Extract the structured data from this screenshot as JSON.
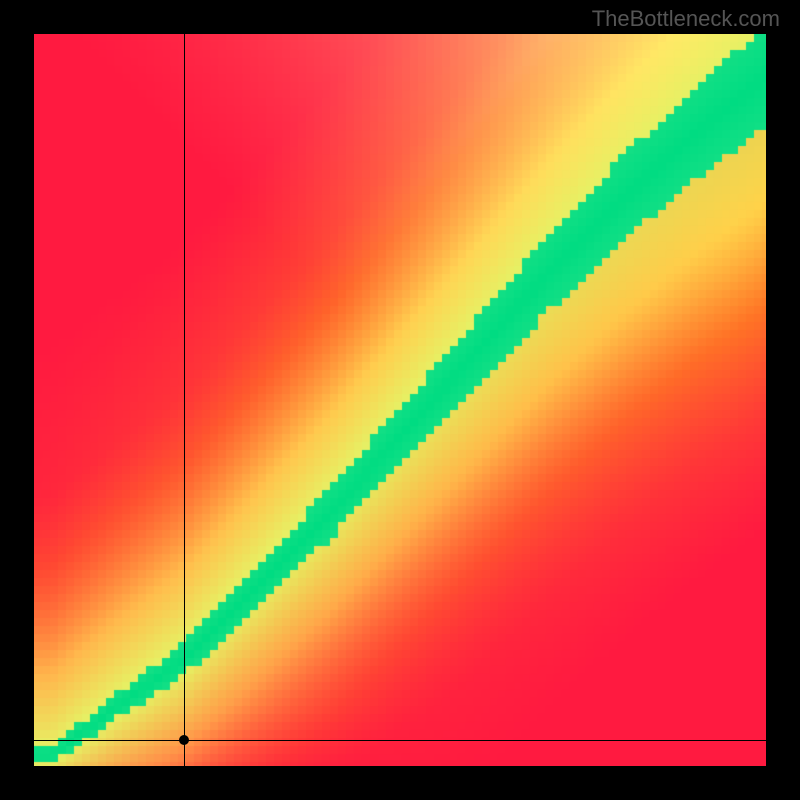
{
  "watermark": "TheBottleneck.com",
  "frame": {
    "outer_w": 800,
    "outer_h": 800,
    "inner_left": 34,
    "inner_top": 34,
    "inner_w": 732,
    "inner_h": 732
  },
  "crosshair": {
    "x_frac": 0.205,
    "y_frac": 0.965
  },
  "chart_data": {
    "type": "heatmap",
    "title": "",
    "xlabel": "",
    "ylabel": "",
    "xlim": [
      0,
      100
    ],
    "ylim": [
      0,
      100
    ],
    "colorscale_note": "red (low) → orange/yellow (mid) → green (optimal ridge) → yellow (high)",
    "marker": {
      "x": 20.5,
      "y": 3.5
    },
    "optimal_ridge": {
      "description": "Green ridge indicating balanced pairing; curve from bottom-left to top-right, slightly convex, widening toward top-right",
      "points": [
        {
          "x": 2,
          "y": 2
        },
        {
          "x": 10,
          "y": 8
        },
        {
          "x": 20,
          "y": 15
        },
        {
          "x": 30,
          "y": 25
        },
        {
          "x": 40,
          "y": 35
        },
        {
          "x": 50,
          "y": 46
        },
        {
          "x": 60,
          "y": 57
        },
        {
          "x": 70,
          "y": 68
        },
        {
          "x": 80,
          "y": 78
        },
        {
          "x": 90,
          "y": 87
        },
        {
          "x": 100,
          "y": 95
        }
      ],
      "width_start": 2,
      "width_end": 14
    },
    "field_anchors": [
      {
        "x": 0,
        "y": 100,
        "color": "#ff1a40"
      },
      {
        "x": 0,
        "y": 0,
        "color": "#ff1a40"
      },
      {
        "x": 100,
        "y": 0,
        "color": "#ff1a40"
      },
      {
        "x": 50,
        "y": 100,
        "color": "#ffb000"
      },
      {
        "x": 100,
        "y": 50,
        "color": "#ffe060"
      },
      {
        "x": 100,
        "y": 100,
        "color": "#ffff9a"
      },
      {
        "x": 50,
        "y": 46,
        "color": "#00e08a"
      },
      {
        "x": 90,
        "y": 87,
        "color": "#00e08a"
      }
    ]
  }
}
